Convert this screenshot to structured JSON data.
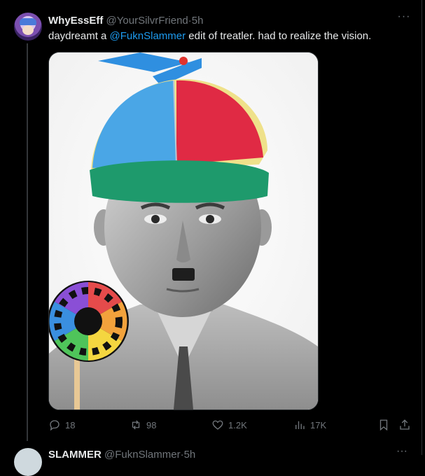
{
  "tweet": {
    "display_name": "WhyEssEff",
    "handle": "@YourSilvrFriend",
    "separator": "·",
    "time": "5h",
    "more": "···",
    "text_prefix": "daydreamt a ",
    "mention": "@FuknSlammer",
    "text_suffix": " edit of treatler. had to realize the vision.",
    "stats": {
      "replies": "18",
      "reposts": "98",
      "likes": "1.2K",
      "views": "17K"
    }
  },
  "next_tweet": {
    "display_name": "SLAMMER",
    "handle": "@FuknSlammer",
    "separator": "·",
    "time": "5h",
    "more": "···"
  },
  "colors": {
    "accent": "#1d9bf0",
    "muted": "#71767b",
    "text": "#e7e9ea",
    "background": "#000000"
  }
}
